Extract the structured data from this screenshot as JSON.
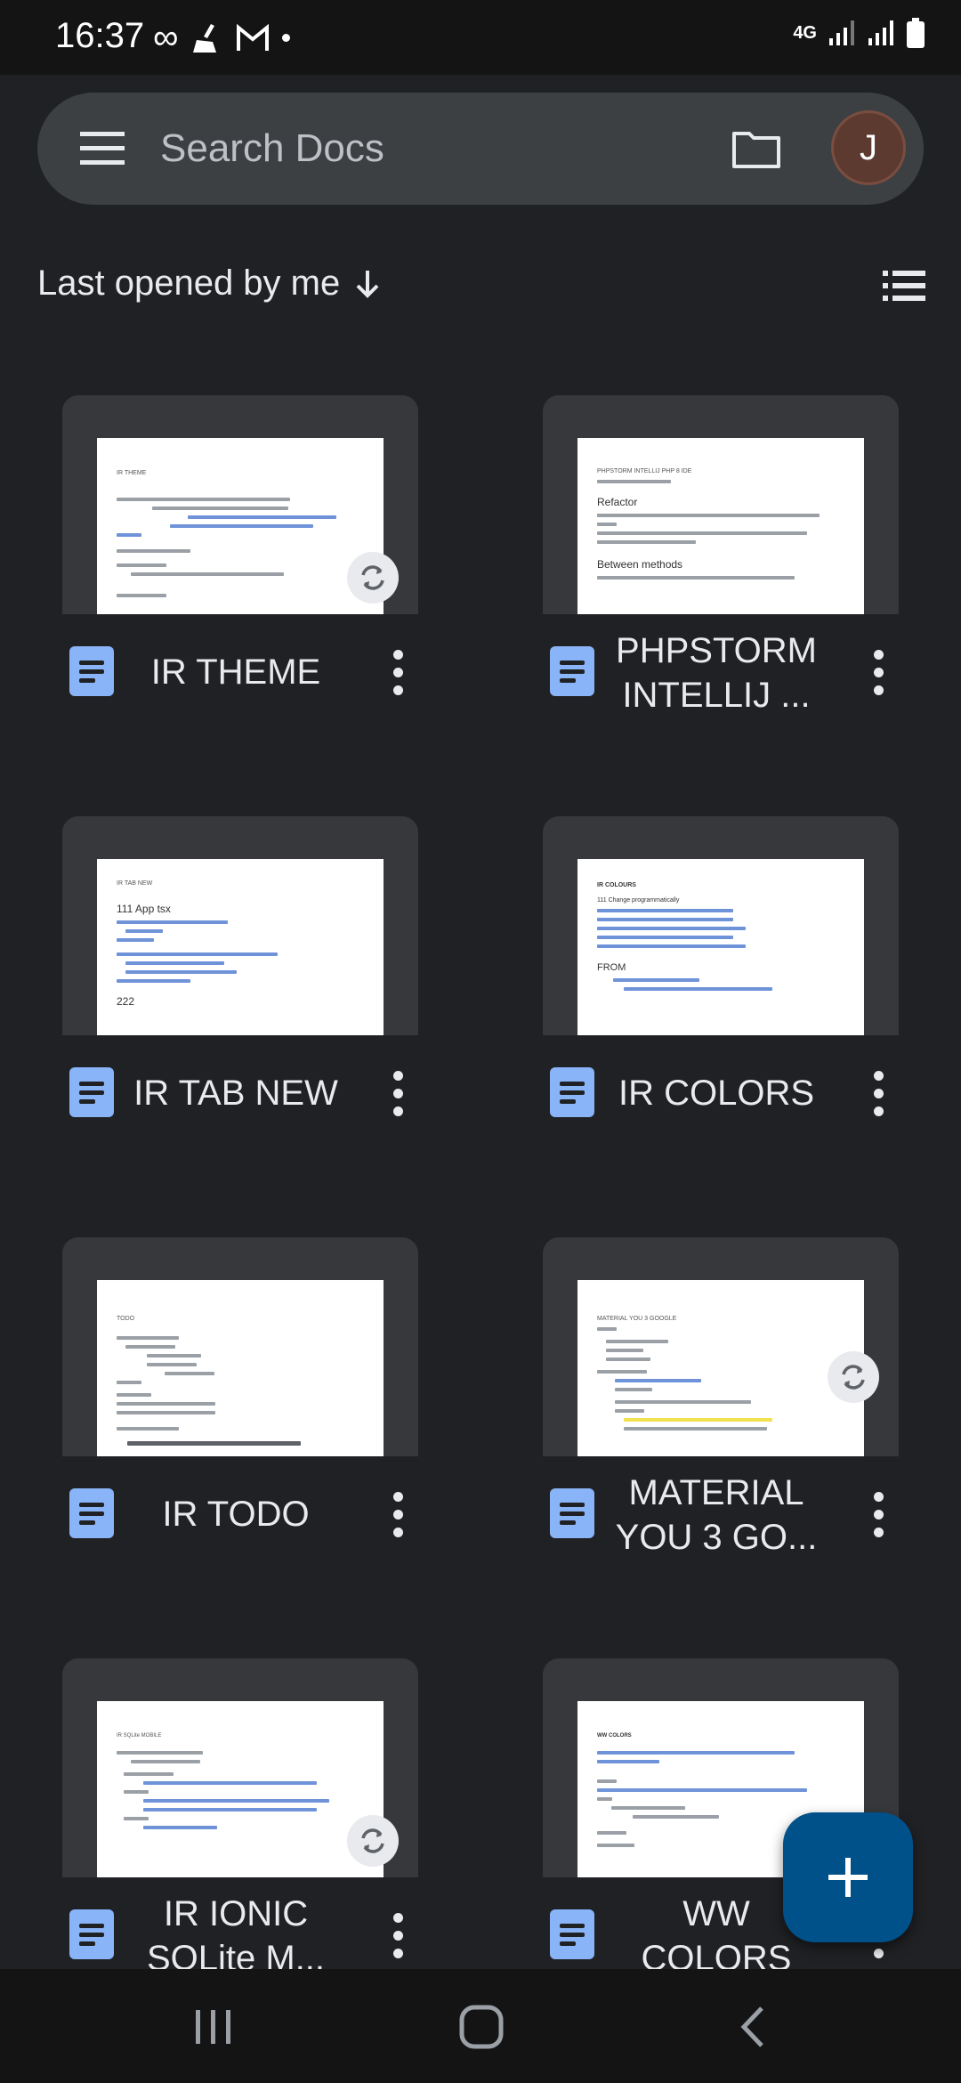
{
  "status_bar": {
    "time": "16:37",
    "network": "4G"
  },
  "search": {
    "placeholder": "Search Docs",
    "avatar_initial": "J"
  },
  "sort": {
    "label": "Last opened by me"
  },
  "documents": [
    {
      "title": "IR THEME",
      "synced_icon": true
    },
    {
      "title": "PHPSTORM INTELLIJ ...",
      "synced_icon": false
    },
    {
      "title": "IR TAB NEW",
      "synced_icon": false
    },
    {
      "title": "IR COLORS",
      "synced_icon": false
    },
    {
      "title": "IR TODO",
      "synced_icon": false
    },
    {
      "title": "MATERIAL YOU 3 GO...",
      "synced_icon": true
    },
    {
      "title": "IR IONIC SQLite M...",
      "synced_icon": true
    },
    {
      "title": "WW COLORS",
      "synced_icon": false
    }
  ],
  "thumbnails": {
    "d0": {
      "heading": "IR THEME"
    },
    "d1": {
      "heading": "PHPSTORM INTELLIJ PHP 8 IDE",
      "sub": "Refactor",
      "sub2": "Between methods"
    },
    "d2": {
      "heading": "IR TAB NEW",
      "sub": "111 App tsx",
      "sub2": "222"
    },
    "d3": {
      "heading": "IR COLOURS",
      "sub": "111 Change programmatically",
      "sub2": "FROM"
    },
    "d4": {
      "heading": "TODO"
    },
    "d5": {
      "heading": "MATERIAL YOU 3 GOOGLE"
    },
    "d6": {
      "heading": "IR SQLite MOBILE"
    },
    "d7": {
      "heading": "WW COLORS"
    }
  },
  "colors": {
    "background": "#202124",
    "doc_icon": "#8ab4f8",
    "fab": "#00518a"
  }
}
